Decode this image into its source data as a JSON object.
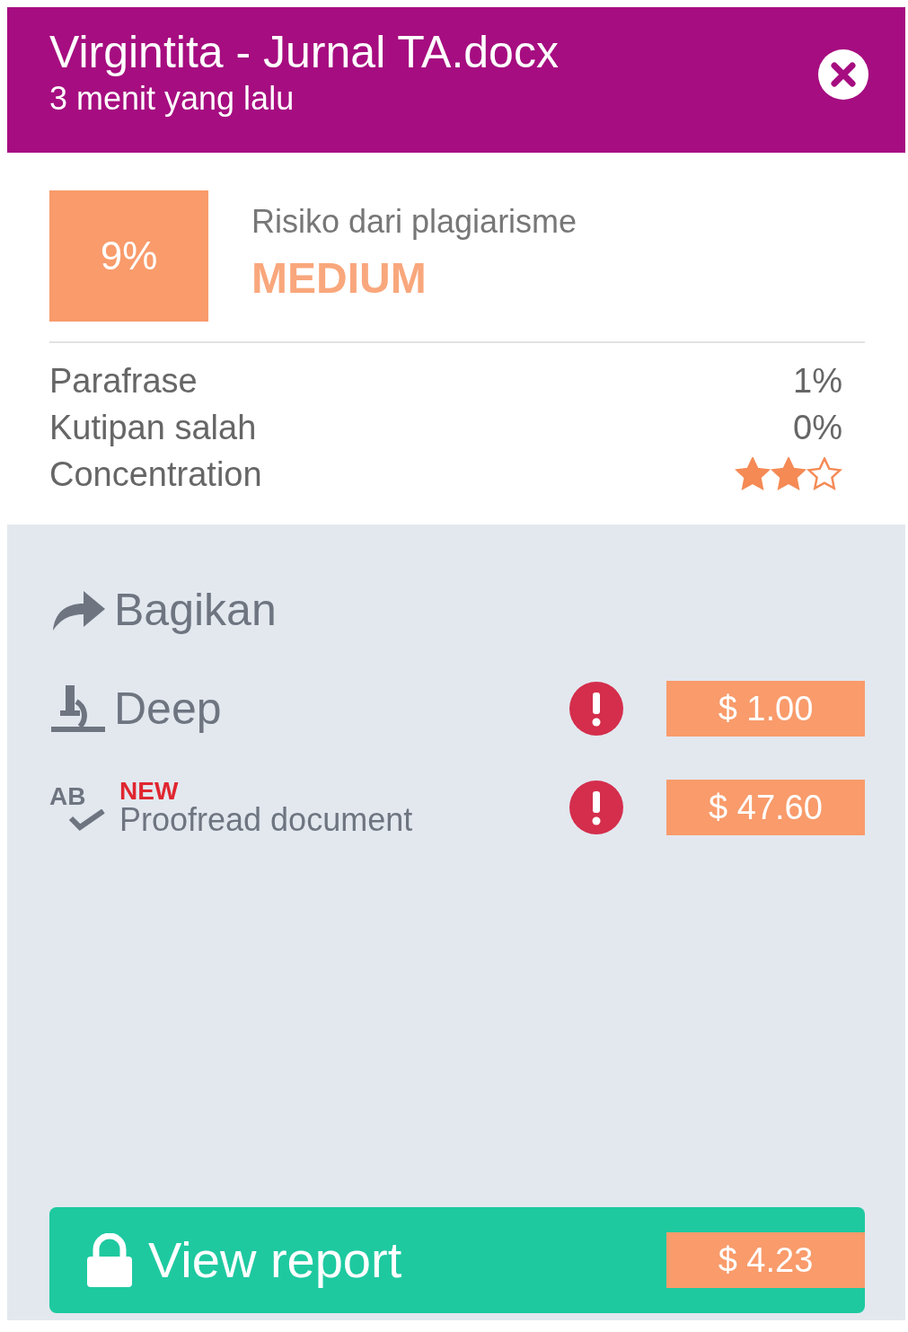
{
  "header": {
    "title": "Virgintita - Jurnal TA.docx",
    "subtitle": "3 menit yang lalu"
  },
  "risk": {
    "percent": "9%",
    "label": "Risiko dari plagiarisme",
    "level_text": "MEDIUM"
  },
  "stats": [
    {
      "kind": "percent",
      "label": "Parafrase",
      "value": "1%"
    },
    {
      "kind": "percent",
      "label": "Kutipan salah",
      "value": "0%"
    },
    {
      "kind": "stars",
      "label": "Concentration",
      "stars": 2
    }
  ],
  "actions": [
    {
      "kind": "share",
      "label": "Bagikan"
    },
    {
      "kind": "deep",
      "label": "Deep",
      "warning": true,
      "price": "$ 1.00"
    },
    {
      "kind": "proofread",
      "label": "Proofread document",
      "badge": "NEW",
      "icon_text": "AB",
      "warning": true,
      "price": "$ 47.60"
    }
  ],
  "view_report": {
    "label": "View report",
    "price": "$ 4.23"
  }
}
